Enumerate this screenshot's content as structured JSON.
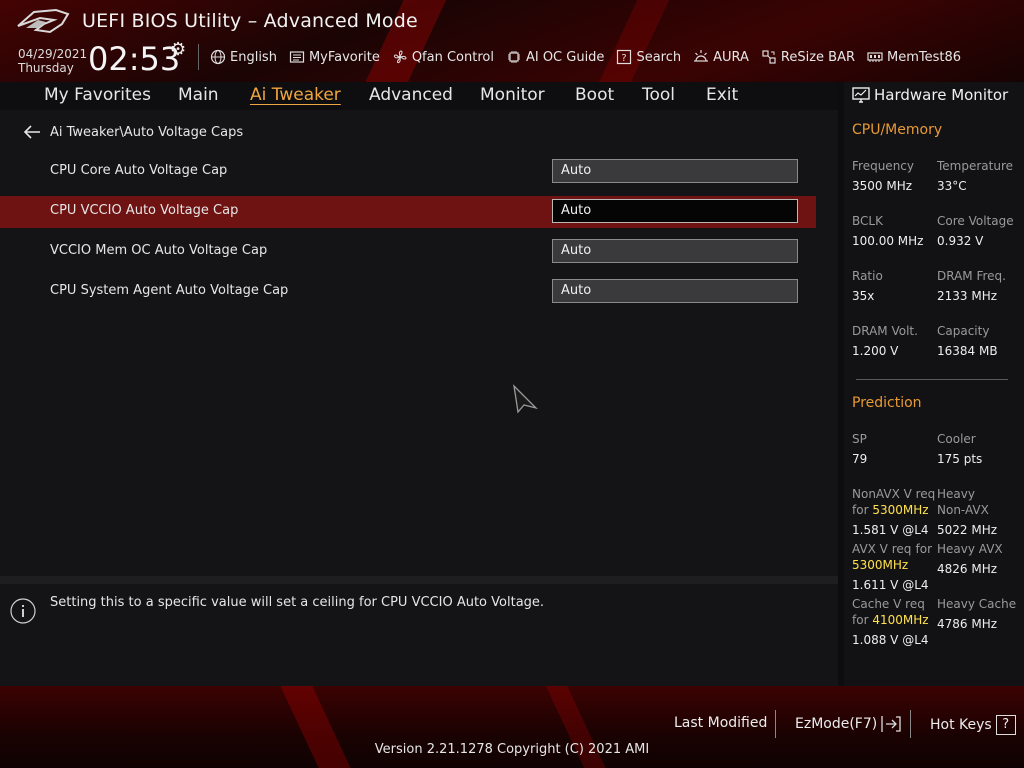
{
  "header": {
    "title": "UEFI BIOS Utility – Advanced Mode",
    "date": "04/29/2021",
    "day": "Thursday",
    "time": "02:53"
  },
  "toolbar": [
    {
      "label": "English",
      "icon": "globe-icon"
    },
    {
      "label": "MyFavorite",
      "icon": "favorite-list-icon"
    },
    {
      "label": "Qfan Control",
      "icon": "fan-icon"
    },
    {
      "label": "AI OC Guide",
      "icon": "chip-icon"
    },
    {
      "label": "Search",
      "icon": "help-box-icon"
    },
    {
      "label": "AURA",
      "icon": "aura-light-icon"
    },
    {
      "label": "ReSize BAR",
      "icon": "resize-bar-icon"
    },
    {
      "label": "MemTest86",
      "icon": "memory-icon"
    }
  ],
  "nav": {
    "tabs": [
      "My Favorites",
      "Main",
      "Ai Tweaker",
      "Advanced",
      "Monitor",
      "Boot",
      "Tool",
      "Exit"
    ],
    "active": "Ai Tweaker"
  },
  "main": {
    "breadcrumb": "Ai Tweaker\\Auto Voltage Caps",
    "rows": [
      {
        "label": "CPU Core Auto Voltage Cap",
        "value": "Auto"
      },
      {
        "label": "CPU VCCIO Auto Voltage Cap",
        "value": "Auto"
      },
      {
        "label": "VCCIO Mem OC Auto Voltage Cap",
        "value": "Auto"
      },
      {
        "label": "CPU System Agent Auto Voltage Cap",
        "value": "Auto"
      }
    ],
    "selected_row": "CPU VCCIO Auto Voltage Cap"
  },
  "help": {
    "text": "Setting this to a specific value will set a ceiling for CPU VCCIO Auto Voltage."
  },
  "hardware_monitor": {
    "title": "Hardware Monitor",
    "cpu_memory": {
      "title": "CPU/Memory",
      "frequency_label": "Frequency",
      "frequency": "3500 MHz",
      "temperature_label": "Temperature",
      "temperature": "33°C",
      "bclk_label": "BCLK",
      "bclk": "100.00 MHz",
      "core_voltage_label": "Core Voltage",
      "core_voltage": "0.932 V",
      "ratio_label": "Ratio",
      "ratio": "35x",
      "dram_freq_label": "DRAM Freq.",
      "dram_freq": "2133 MHz",
      "dram_volt_label": "DRAM Volt.",
      "dram_volt": "1.200 V",
      "capacity_label": "Capacity",
      "capacity": "16384 MB"
    },
    "prediction": {
      "title": "Prediction",
      "sp_label": "SP",
      "sp": "79",
      "cooler_label": "Cooler",
      "cooler": "175 pts",
      "nonavx_label": "NonAVX V req",
      "nonavx_for": "for",
      "nonavx_freq": "5300MHz",
      "nonavx_value": "1.581 V @L4",
      "heavy_nonavx_label1": "Heavy",
      "heavy_nonavx_label2": "Non-AVX",
      "heavy_nonavx": "5022 MHz",
      "avx_label": "AVX V req",
      "avx_for": "for",
      "avx_freq": "5300MHz",
      "avx_value": "1.611 V @L4",
      "heavy_avx_label": "Heavy AVX",
      "heavy_avx": "4826 MHz",
      "cache_label": "Cache V req",
      "cache_for": "for",
      "cache_freq": "4100MHz",
      "cache_value": "1.088 V @L4",
      "heavy_cache_label": "Heavy Cache",
      "heavy_cache": "4786 MHz"
    }
  },
  "footer": {
    "last_modified": "Last Modified",
    "ezmode": "EzMode(F7)",
    "hot_keys": "Hot Keys",
    "hot_keys_key": "?",
    "version": "Version 2.21.1278 Copyright (C) 2021 AMI"
  },
  "colors": {
    "accent": "#f0a640",
    "section": "#e89a35",
    "highlight": "#ffe14b",
    "selected_row": "#6e1212"
  }
}
